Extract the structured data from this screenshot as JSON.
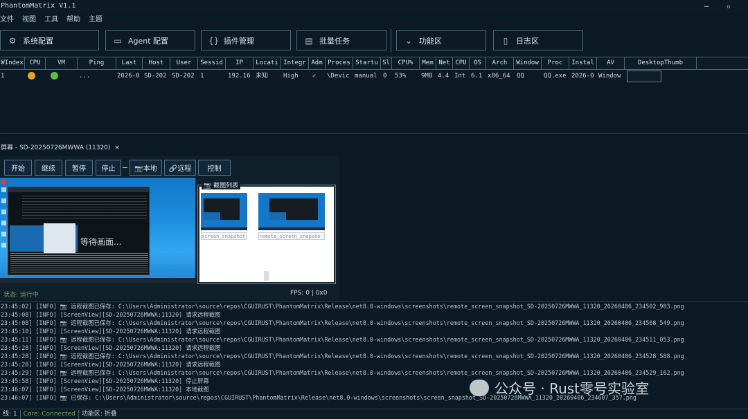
{
  "app": {
    "title": "PhantomMatrix V1.1",
    "minimize": "–",
    "maximize": "▫"
  },
  "menu": [
    "文件",
    "视图",
    "工具",
    "帮助",
    "主题"
  ],
  "toolbar": [
    {
      "icon": "gear-icon",
      "glyph": "⚙",
      "label": "系统配置"
    },
    {
      "icon": "monitor-icon",
      "glyph": "▭",
      "label": "Agent 配置"
    },
    {
      "icon": "braces-icon",
      "glyph": "{}",
      "label": "插件管理"
    },
    {
      "icon": "document-icon",
      "glyph": "▤",
      "label": "批量任务"
    },
    {
      "icon": "chevron-down-icon",
      "glyph": "⌄",
      "label": "功能区"
    },
    {
      "icon": "log-icon",
      "glyph": "▯",
      "label": "日志区"
    }
  ],
  "grid": {
    "columns": [
      "WIndex",
      "CPU",
      "VM",
      "Ping",
      "Last",
      "Host",
      "User",
      "Sessid",
      "IP",
      "Locati",
      "Integr",
      "Adm",
      "Proces",
      "Startu",
      "Sl",
      "CPU%",
      "Mem",
      "Net",
      "CPU",
      "OS",
      "Arch",
      "Window",
      "Proc",
      "Instal",
      "AV",
      "DesktopThumb"
    ],
    "row": {
      "index": "1",
      "cpu_status": "#f0a020",
      "vm_status": "#5cbf3a",
      "ping": "...",
      "last": "2026-0",
      "host": "SD-202",
      "user": "SD-202",
      "sessid": "1",
      "ip": "192.16",
      "location": "未知",
      "integrity": "High",
      "admin": "✔",
      "process": "\\Devic",
      "startup": "manual",
      "sleep": "0",
      "cpu_pct": "53%",
      "mem": "9MB",
      "net": "4.4",
      "cpu": "Int",
      "os": "6.1",
      "arch": "x86_64",
      "window": "QQ",
      "proc": "QQ.exe",
      "install": "2026-0",
      "av": "Window"
    }
  },
  "screen": {
    "tab_title": "屏幕 - SD-20250726MWWA (11320)",
    "tab_close": "×",
    "controls": [
      "开始",
      "继续",
      "暂停",
      "停止"
    ],
    "local_label": "📷本地",
    "remote_label": "🔗远程",
    "control_label": "控制",
    "waiting_text": "等待画面...",
    "screenshot_list_title": "📷 截图列表",
    "snapshots": [
      "screen_snapshot",
      "remote_screen_snapsho"
    ],
    "status_text": "状态: 运行中",
    "fps_text": "FPS: 0 | 0x0"
  },
  "log": [
    "23:45:02] [INFO] 📷 远程截图已保存: C:\\Users\\Administrator\\source\\repos\\CGUIRUST\\PhantomMatrix\\Release\\net8.0-windows\\screenshots\\remote_screen_snapshot_SD-20250726MWWA_11320_20260406_234502_983.png",
    "23:45:08] [INFO] [ScreenView][SD-20250726MWWA:11320] 请求远程截图",
    "23:45:08] [INFO] 📷 远程截图已保存: C:\\Users\\Administrator\\source\\repos\\CGUIRUST\\PhantomMatrix\\Release\\net8.0-windows\\screenshots\\remote_screen_snapshot_SD-20250726MWWA_11320_20260406_234508_549.png",
    "23:45:10] [INFO] [ScreenView][SD-20250726MWWA:11320] 请求远程截图",
    "23:45:11] [INFO] 📷 远程截图已保存: C:\\Users\\Administrator\\source\\repos\\CGUIRUST\\PhantomMatrix\\Release\\net8.0-windows\\screenshots\\remote_screen_snapshot_SD-20250726MWWA_11320_20260406_234511_053.png",
    "23:45:28] [INFO] [ScreenView][SD-20250726MWWA:11320] 请求远程截图",
    "23:45:28] [INFO] 📷 远程截图已保存: C:\\Users\\Administrator\\source\\repos\\CGUIRUST\\PhantomMatrix\\Release\\net8.0-windows\\screenshots\\remote_screen_snapshot_SD-20250726MWWA_11320_20260406_234528_588.png",
    "23:45:28] [INFO] [ScreenView][SD-20250726MWWA:11320] 请求远程截图",
    "23:45:29] [INFO] 📷 远程截图已保存: C:\\Users\\Administrator\\source\\repos\\CGUIRUST\\PhantomMatrix\\Release\\net8.0-windows\\screenshots\\remote_screen_snapshot_SD-20250726MWWA_11320_20260406_234529_162.png",
    "23:45:58] [INFO] [ScreenView][SD-20250726MWWA:11320] 停止屏幕",
    "23:46:07] [INFO] [ScreenView][SD-20250726MWWA:11320] 本地截图",
    "23:46:07] [INFO] 📷 已保存: C:\\Users\\Administrator\\source\\repos\\CGUIRUST\\PhantomMatrix\\Release\\net8.0-windows\\screenshots\\screen_snapshot_SD-20250726MWWA_11320_20260406_234607_357.png"
  ],
  "watermark": "公众号 · Rust零号实验室",
  "statusbar": [
    "线: 1",
    "Core: Connected",
    "功能区: 折叠"
  ],
  "colors": {
    "accent": "#2f7fb5",
    "connected": "#6fa15f",
    "background": "#0b1a24"
  }
}
